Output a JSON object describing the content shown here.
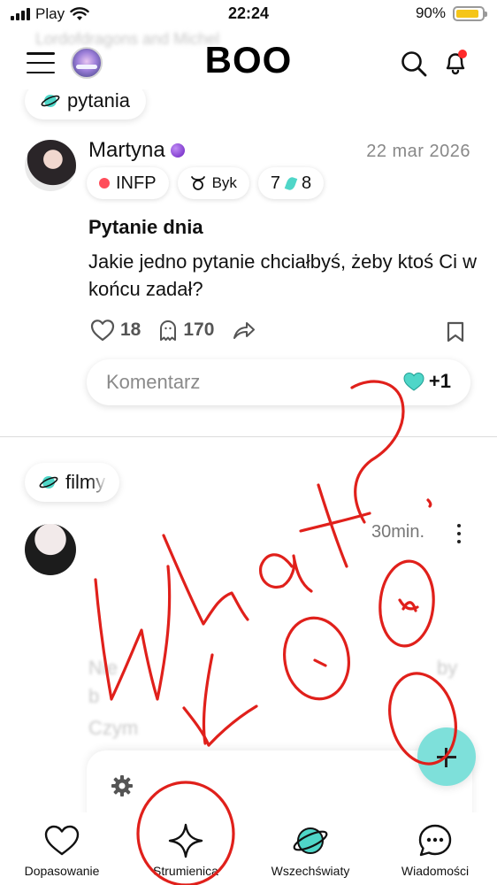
{
  "status_bar": {
    "carrier": "Play",
    "time": "22:24",
    "battery": "90%",
    "battery_level": 0.9
  },
  "header": {
    "logo": "BOO",
    "banner_text": "Lordofdragons and Michel"
  },
  "top_chip": {
    "label": "pytania"
  },
  "post1": {
    "author": "Martyna",
    "date": "22 mar 2026",
    "tags": {
      "mbti": "INFP",
      "zodiac": "Byk",
      "enneagram_left": "7",
      "enneagram_right": "8"
    },
    "title": "Pytanie dnia",
    "body": "Jakie jedno pytanie chciałbyś, żeby ktoś Ci w końcu zadał?",
    "likes": "18",
    "comments": "170",
    "comment_placeholder": "Komentarz",
    "gem_bonus": "+1"
  },
  "post2": {
    "chip": "filmy",
    "time": "30min.",
    "snippet_start": "Nie",
    "snippet_line2": "b",
    "snippet_end": "by",
    "snippet_faded": "Czym"
  },
  "annotation": {
    "text": "What?",
    "color": "#e0201b"
  },
  "bottom_nav": {
    "items": [
      {
        "label": "Dopasowanie",
        "icon": "heart-icon"
      },
      {
        "label": "Strumienica",
        "icon": "sparkle-icon"
      },
      {
        "label": "Wszechświaty",
        "icon": "planet-icon"
      },
      {
        "label": "Wiadomości",
        "icon": "chat-bubble-icon"
      }
    ]
  },
  "colors": {
    "accent": "#4fd6c8",
    "fab": "#7ee0da",
    "notification": "#ff2a2a",
    "mbti_dot": "#ff4d5a",
    "premium": "#7a2fd0"
  }
}
